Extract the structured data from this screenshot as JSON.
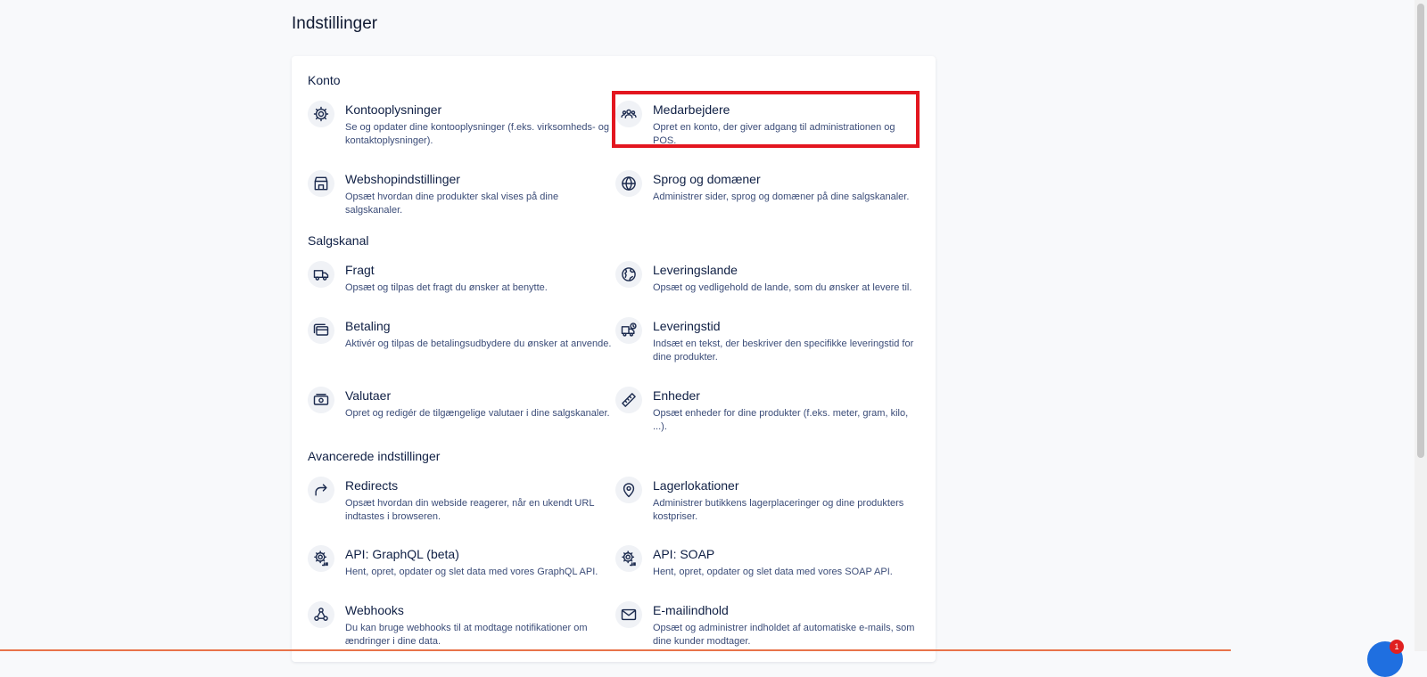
{
  "page": {
    "title": "Indstillinger"
  },
  "sections": {
    "konto": {
      "title": "Konto",
      "items": [
        {
          "name": "Kontooplysninger",
          "desc": "Se og opdater dine kontooplysninger (f.eks. virksomheds- og kontaktoplysninger).",
          "icon": "gear-icon"
        },
        {
          "name": "Medarbejdere",
          "desc": "Opret en konto, der giver adgang til administrationen og POS.",
          "icon": "users-icon"
        },
        {
          "name": "Webshopindstillinger",
          "desc": "Opsæt hvordan dine produkter skal vises på dine salgskanaler.",
          "icon": "store-icon"
        },
        {
          "name": "Sprog og domæner",
          "desc": "Administrer sider, sprog og domæner på dine salgskanaler.",
          "icon": "globe-icon"
        }
      ]
    },
    "salgskanal": {
      "title": "Salgskanal",
      "items": [
        {
          "name": "Fragt",
          "desc": "Opsæt og tilpas det fragt du ønsker at benytte.",
          "icon": "truck-icon"
        },
        {
          "name": "Leveringslande",
          "desc": "Opsæt og vedligehold de lande, som du ønsker at levere til.",
          "icon": "earth-icon"
        },
        {
          "name": "Betaling",
          "desc": "Aktivér og tilpas de betalingsudbydere du ønsker at anvende.",
          "icon": "payment-icon"
        },
        {
          "name": "Leveringstid",
          "desc": "Indsæt en tekst, der beskriver den specifikke leveringstid for dine produkter.",
          "icon": "delivery-time-icon"
        },
        {
          "name": "Valutaer",
          "desc": "Opret og redigér de tilgængelige valutaer i dine salgskanaler.",
          "icon": "cash-icon"
        },
        {
          "name": "Enheder",
          "desc": "Opsæt enheder for dine produkter (f.eks. meter, gram, kilo, ...).",
          "icon": "ruler-icon"
        }
      ]
    },
    "avanceret": {
      "title": "Avancerede indstillinger",
      "items": [
        {
          "name": "Redirects",
          "desc": "Opsæt hvordan din webside reagerer, når en ukendt URL indtastes i browseren.",
          "icon": "redirect-icon"
        },
        {
          "name": "Lagerlokationer",
          "desc": "Administrer butikkens lagerplaceringer og dine produkters kostpriser.",
          "icon": "location-pin-icon"
        },
        {
          "name": "API: GraphQL (beta)",
          "desc": "Hent, opret, opdater og slet data med vores GraphQL API.",
          "icon": "api-gear-icon"
        },
        {
          "name": "API: SOAP",
          "desc": "Hent, opret, opdater og slet data med vores SOAP API.",
          "icon": "api-gear-icon"
        },
        {
          "name": "Webhooks",
          "desc": "Du kan bruge webhooks til at modtage notifikationer om ændringer i dine data.",
          "icon": "webhook-icon"
        },
        {
          "name": "E-mailindhold",
          "desc": "Opsæt og administrer indholdet af automatiske e-mails, som dine kunder modtager.",
          "icon": "mail-icon"
        }
      ]
    }
  },
  "chat": {
    "badge": "1"
  },
  "colors": {
    "highlight": "#e3161f",
    "text": "#0f1f44",
    "desc": "#3b4c78"
  }
}
